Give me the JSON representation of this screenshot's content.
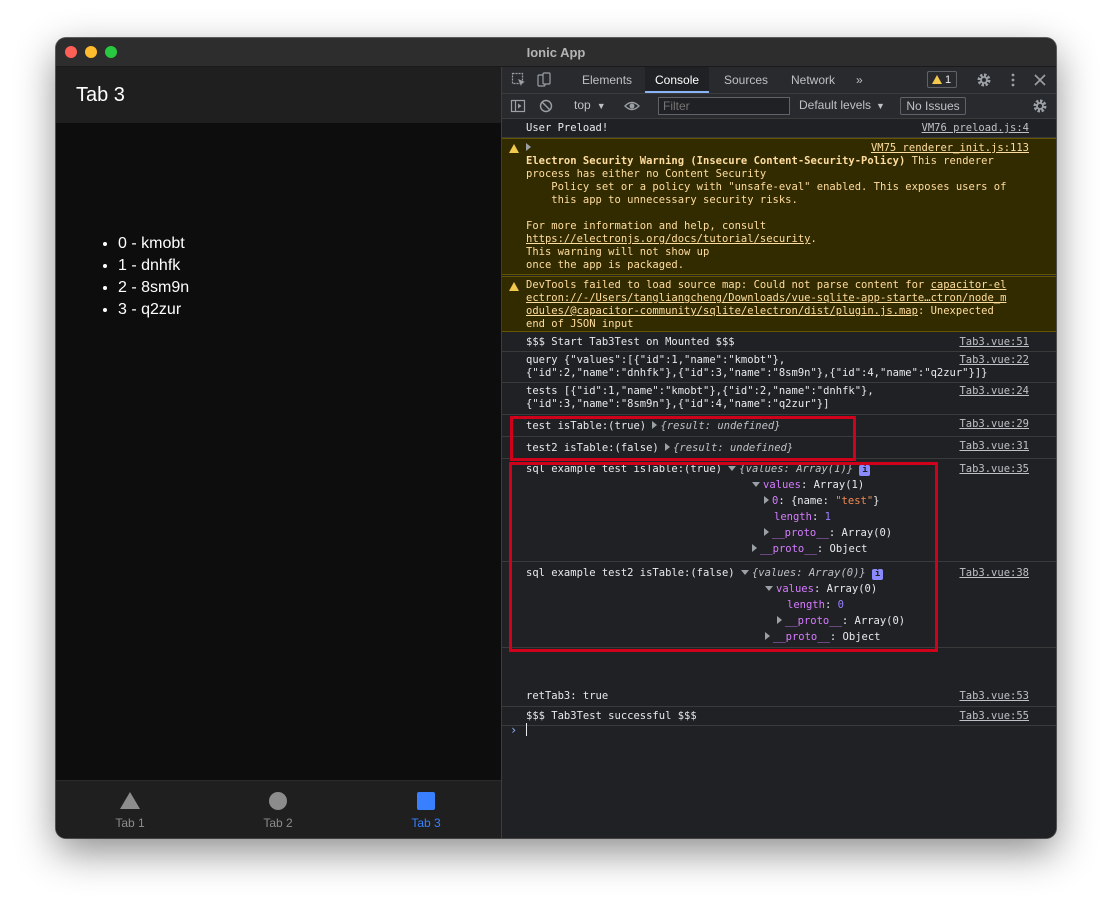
{
  "window": {
    "title": "Ionic App"
  },
  "app": {
    "header_title": "Tab 3",
    "items": [
      "0 - kmobt",
      "1 - dnhfk",
      "2 - 8sm9n",
      "3 - q2zur"
    ],
    "tabs": [
      {
        "label": "Tab 1",
        "icon": "triangle-icon",
        "active": false
      },
      {
        "label": "Tab 2",
        "icon": "circle-icon",
        "active": false
      },
      {
        "label": "Tab 3",
        "icon": "square-icon",
        "active": true
      }
    ],
    "accent_color": "#3880ff"
  },
  "devtools": {
    "tabs": [
      "Elements",
      "Console",
      "Sources",
      "Network"
    ],
    "active_tab": "Console",
    "warning_count": "1",
    "context": "top",
    "filter_placeholder": "Filter",
    "levels": "Default levels",
    "issues": "No Issues",
    "messages": {
      "m1": {
        "text": "User Preload!",
        "src": "VM76 preload.js:4"
      },
      "m2": {
        "src": "VM75 renderer_init.js:113",
        "title": "Electron Security Warning (Insecure Content-Security-Policy)",
        "l1": " This renderer",
        "l2": "process has either no Content Security",
        "l3": "    Policy set or a policy with \"unsafe-eval\" enabled. This exposes users of",
        "l4": "    this app to unnecessary security risks.",
        "l5": "For more information and help, consult",
        "link": "https://electronjs.org/docs/tutorial/security",
        "dot": ".",
        "l6": "This warning will not show up",
        "l7": "once the app is packaged."
      },
      "m3": {
        "l1a": "DevTools failed to load source map: Could not parse content for ",
        "l1b": "capacitor-el",
        "l2": "ectron://-/Users/tangliangcheng/Downloads/vue-sqlite-app-starte…ctron/node_m",
        "l3a": "odules/@capacitor-community/sqlite/electron/dist/plugin.js.map",
        "l3b": ": Unexpected",
        "l4": "end of JSON input"
      },
      "m4": {
        "text": "$$$ Start Tab3Test on Mounted $$$",
        "src": "Tab3.vue:51"
      },
      "m5": {
        "l1": "query {\"values\":[{\"id\":1,\"name\":\"kmobt\"},",
        "l2": "{\"id\":2,\"name\":\"dnhfk\"},{\"id\":3,\"name\":\"8sm9n\"},{\"id\":4,\"name\":\"q2zur\"}]}",
        "src": "Tab3.vue:22"
      },
      "m6": {
        "l1": "tests [{\"id\":1,\"name\":\"kmobt\"},{\"id\":2,\"name\":\"dnhfk\"},",
        "l2": "{\"id\":3,\"name\":\"8sm9n\"},{\"id\":4,\"name\":\"q2zur\"}]",
        "src": "Tab3.vue:24"
      },
      "m7": {
        "text": "test isTable:(true) ",
        "obj": "{result: undefined}",
        "src": "Tab3.vue:29"
      },
      "m8": {
        "text": "test2 isTable:(false) ",
        "obj": "{result: undefined}",
        "src": "Tab3.vue:31"
      },
      "m9": {
        "text": "sql example test isTable:(true) ",
        "obj": "{values: Array(1)}",
        "values_key": "values",
        "values_val": ": Array(1)",
        "item_key": "0",
        "item_pre": ": {name: ",
        "item_str": "\"test\"",
        "item_post": "}",
        "length_key": "length",
        "length_val": "1",
        "proto_key": "__proto__",
        "proto_arr": ": Array(0)",
        "proto_obj": ": Object",
        "src": "Tab3.vue:35"
      },
      "m10": {
        "text": "sql example test2 isTable:(false) ",
        "obj": "{values: Array(0)}",
        "values_key": "values",
        "values_val": ": Array(0)",
        "length_key": "length",
        "length_val": "0",
        "proto_key": "__proto__",
        "proto_arr": ": Array(0)",
        "proto_obj": ": Object",
        "src": "Tab3.vue:38"
      },
      "m11": {
        "text": "retTab3: true",
        "src": "Tab3.vue:53"
      },
      "m12": {
        "text": "$$$ Tab3Test successful $$$",
        "src": "Tab3.vue:55"
      }
    },
    "prompt": "›",
    "info_badge": "i"
  }
}
